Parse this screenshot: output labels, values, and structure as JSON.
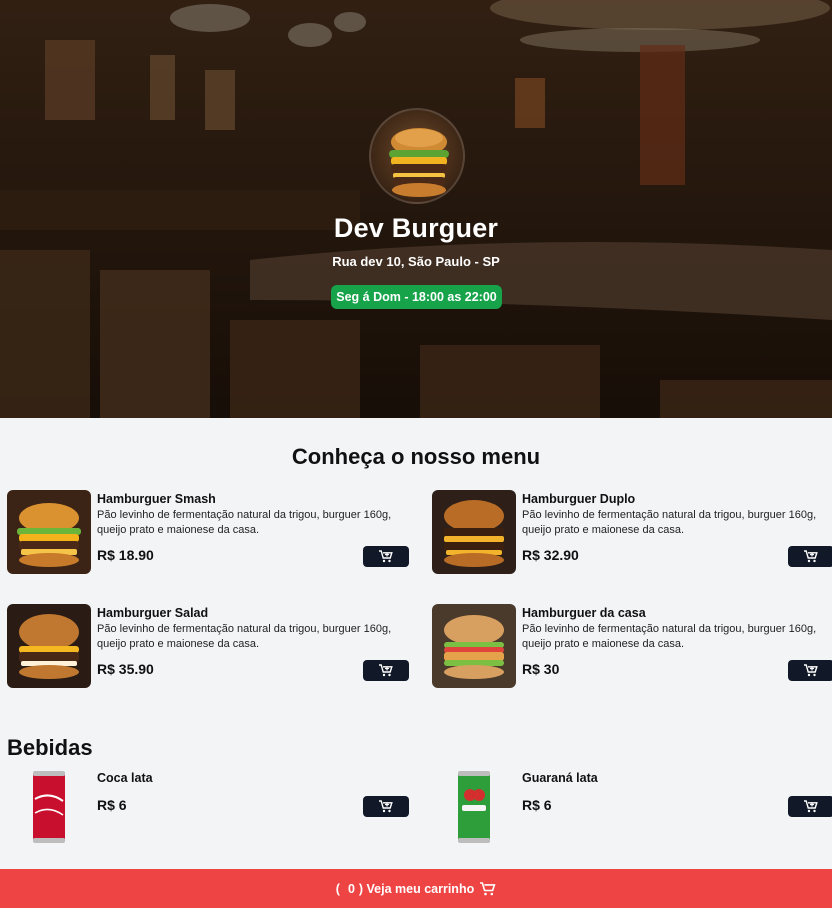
{
  "header": {
    "restaurant_name": "Dev Burguer",
    "address": "Rua dev 10, São Paulo - SP",
    "hours": "Seg á Dom - 18:00 as 22:00"
  },
  "menu": {
    "title": "Conheça o nosso menu",
    "items": [
      {
        "name": "Hamburguer Smash",
        "description": "Pão levinho de fermentação natural da trigou, burguer 160g, queijo prato e maionese da casa.",
        "price": "R$ 18.90",
        "icon": "cart-plus-icon"
      },
      {
        "name": "Hamburguer Duplo",
        "description": "Pão levinho de fermentação natural da trigou, burguer 160g, queijo prato e maionese da casa.",
        "price": "R$ 32.90",
        "icon": "cart-plus-icon"
      },
      {
        "name": "Hamburguer Salad",
        "description": "Pão levinho de fermentação natural da trigou, burguer 160g, queijo prato e maionese da casa.",
        "price": "R$ 35.90",
        "icon": "cart-plus-icon"
      },
      {
        "name": "Hamburguer da casa",
        "description": "Pão levinho de fermentação natural da trigou, burguer 160g, queijo prato e maionese da casa.",
        "price": "R$ 30",
        "icon": "cart-plus-icon"
      }
    ]
  },
  "drinks": {
    "title": "Bebidas",
    "items": [
      {
        "name": "Coca lata",
        "price": "R$ 6",
        "icon": "cart-plus-icon"
      },
      {
        "name": "Guaraná lata",
        "price": "R$ 6",
        "icon": "cart-plus-icon"
      }
    ]
  },
  "footer": {
    "open_paren": "(",
    "cart_count": "0",
    "label": ") Veja meu carrinho",
    "icon": "cart-icon"
  },
  "colors": {
    "accent_red": "#ef4444",
    "hours_green": "#16a34a",
    "button_dark": "#111827"
  }
}
